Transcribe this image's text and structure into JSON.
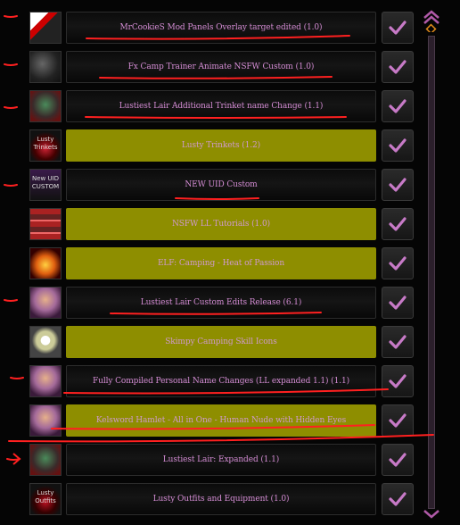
{
  "mods": [
    {
      "name": "MrCookieS Mod Panels Overlay target edited (1.0)",
      "enabled": true,
      "highlighted": false,
      "thumb_icon": "pixel-art-icon"
    },
    {
      "name": "Fx Camp Trainer Animate NSFW Custom (1.0)",
      "enabled": true,
      "highlighted": false,
      "thumb_icon": "dark-figure-icon"
    },
    {
      "name": "Lustiest Lair Additional Trinket name Change (1.1)",
      "enabled": true,
      "highlighted": false,
      "thumb_icon": "green-creature-icon"
    },
    {
      "name": "Lusty Trinkets (1.2)",
      "enabled": true,
      "highlighted": true,
      "thumb_icon": "heart-trinket-icon",
      "thumb_text": "Lusty Trinkets"
    },
    {
      "name": "NEW UID Custom",
      "enabled": true,
      "highlighted": false,
      "thumb_icon": "new-uid-icon",
      "thumb_text": "New UID CUSTOM"
    },
    {
      "name": "NSFW LL Tutorials (1.0)",
      "enabled": true,
      "highlighted": true,
      "thumb_icon": "red-poster-icon"
    },
    {
      "name": "ELF: Camping - Heat of Passion",
      "enabled": true,
      "highlighted": true,
      "thumb_icon": "fire-icon"
    },
    {
      "name": "Lustiest Lair Custom Edits Release (6.1)",
      "enabled": true,
      "highlighted": false,
      "thumb_icon": "character-portrait-icon"
    },
    {
      "name": "Skimpy Camping Skill Icons",
      "enabled": true,
      "highlighted": true,
      "thumb_icon": "skill-icon"
    },
    {
      "name": "Fully Compiled Personal Name Changes (LL expanded 1.1) (1.1)",
      "enabled": true,
      "highlighted": false,
      "thumb_icon": "character-portrait-icon"
    },
    {
      "name": "Kelsword Hamlet - All in One - Human Nude with Hidden Eyes",
      "enabled": true,
      "highlighted": true,
      "thumb_icon": "character-portrait-icon"
    },
    {
      "name": "Lustiest Lair: Expanded (1.1)",
      "enabled": true,
      "highlighted": false,
      "thumb_icon": "green-creature-icon"
    },
    {
      "name": "Lusty Outfits and Equipment (1.0)",
      "enabled": true,
      "highlighted": false,
      "thumb_icon": "heart-outfit-icon",
      "thumb_text": "Lusty Outfits"
    }
  ],
  "colors": {
    "title_text": "#d48cd4",
    "check_mark": "#c77ac7",
    "highlight": "#9a9a00",
    "annotation_red": "#ff2020",
    "scroll_accent": "#c86ab8"
  }
}
